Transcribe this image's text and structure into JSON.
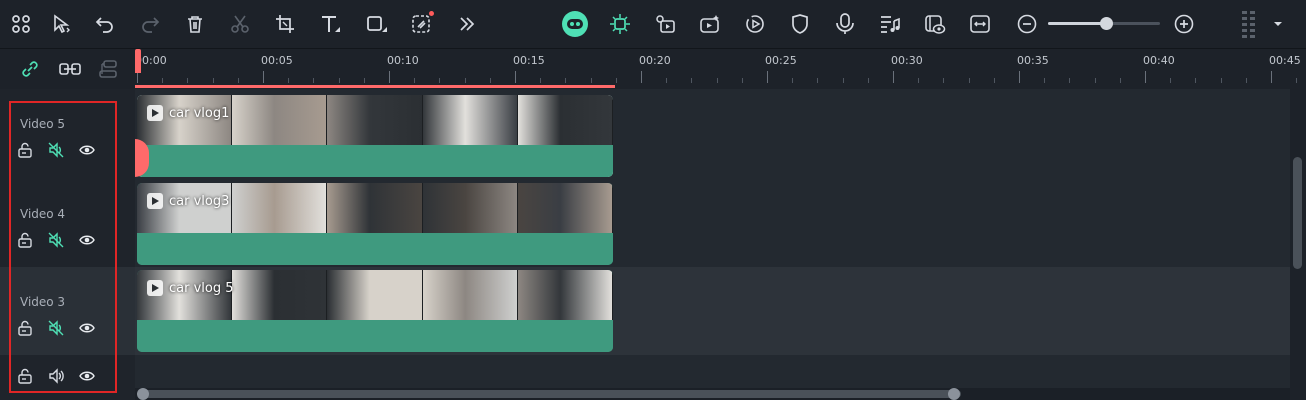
{
  "toolbar": {
    "left_icons": [
      "grid-icon",
      "select-arrow-icon",
      "undo-icon",
      "redo-icon",
      "delete-icon",
      "cut-icon",
      "crop-icon",
      "text-icon",
      "shape-icon",
      "ai-cutout-icon",
      "more-icon"
    ],
    "center_icons": [
      "ai-copilot-icon",
      "auto-highlight-icon",
      "smart-cutout-icon",
      "ai-video-icon",
      "speed-icon",
      "mask-icon",
      "voiceover-icon",
      "audio-stretch-icon",
      "preview-render-icon",
      "fit-width-icon"
    ],
    "zoom_level": 0.52
  },
  "track_tools": [
    "link-icon",
    "chain-clip-icon",
    "detach-icon"
  ],
  "ruler": {
    "ticks": [
      "00:00",
      "00:05",
      "00:10",
      "00:15",
      "00:20",
      "00:25",
      "00:30",
      "00:35",
      "00:40",
      "00:45"
    ]
  },
  "tracks": [
    {
      "label": "Video 5",
      "audio": "muted",
      "clip": {
        "title": "car vlog1",
        "selected": true
      }
    },
    {
      "label": "Video 4",
      "audio": "muted",
      "clip": {
        "title": "car vlog3",
        "selected": false
      }
    },
    {
      "label": "Video 3",
      "audio": "muted",
      "clip": {
        "title": "car vlog 5",
        "selected": false
      }
    },
    {
      "label": "",
      "audio": "on",
      "clip": null
    }
  ],
  "colors": {
    "accent": "#4fe0b5",
    "clip": "#3f9a7f",
    "playhead": "#ff6a6a",
    "highlight_box": "#e02626"
  }
}
